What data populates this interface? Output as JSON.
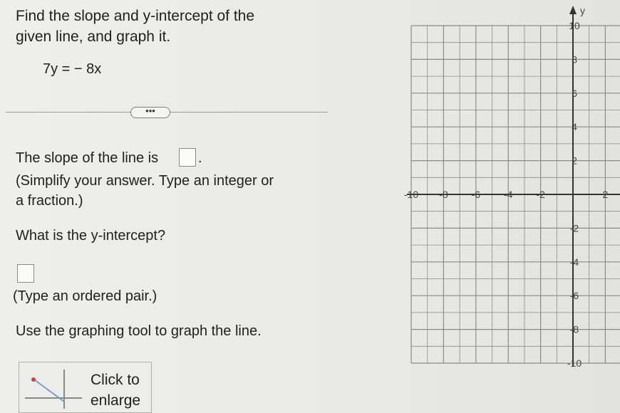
{
  "question": {
    "title": "Find the slope and y-intercept of the given line, and graph it.",
    "equation": "7y = − 8x",
    "more_button": "•••"
  },
  "slope_section": {
    "prompt_prefix": "The slope of the line is",
    "prompt_suffix": ".",
    "hint_line1": "(Simplify your answer. Type an integer or",
    "hint_line2": "a fraction.)",
    "answer_value": ""
  },
  "intercept_section": {
    "prompt": "What is the y-intercept?",
    "answer_value": "",
    "hint": "(Type an ordered pair.)"
  },
  "graph_instruction": "Use the graphing tool to graph the line.",
  "enlarge": {
    "line1": "Click to",
    "line2": "enlarge"
  },
  "graph": {
    "y_axis_label": "y",
    "x_ticks": [
      "-10",
      "-8",
      "-6",
      "-4",
      "-2",
      "2"
    ],
    "y_ticks": [
      "10",
      "8",
      "6",
      "4",
      "2",
      "-2",
      "-4",
      "-6",
      "-8",
      "-10"
    ],
    "x_range": [
      -10,
      10
    ],
    "y_range": [
      -10,
      10
    ],
    "grid": true
  }
}
